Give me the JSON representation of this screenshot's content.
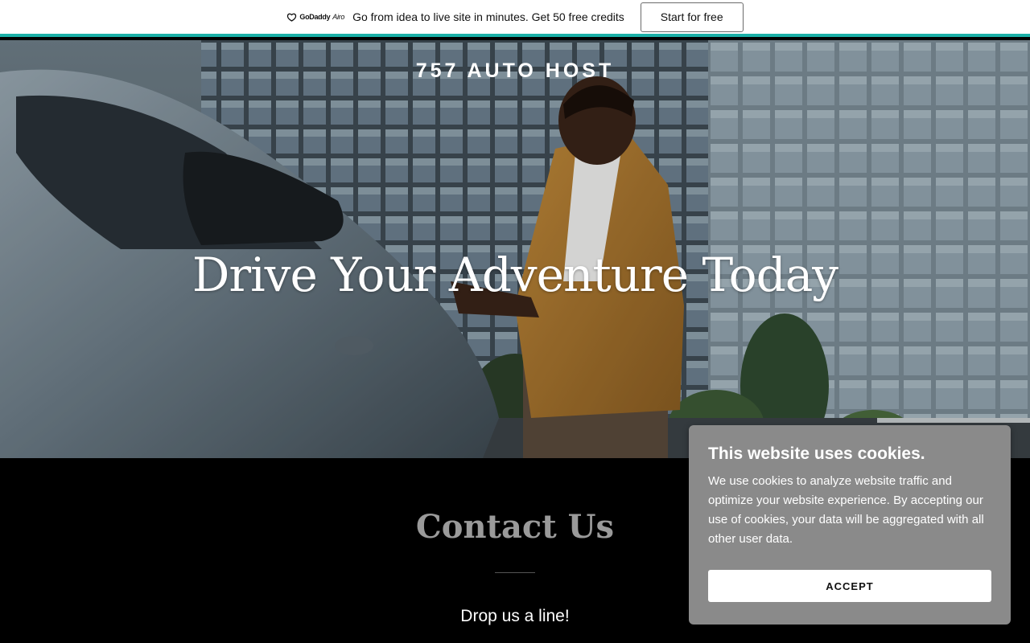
{
  "promo": {
    "logo_brand": "GoDaddy",
    "logo_product": "Airo",
    "message": "Go from idea to live site in minutes. Get 50 free credits",
    "cta_label": "Start for free",
    "accent_color": "#1bb0a8"
  },
  "hero": {
    "site_title": "757 AUTO HOST",
    "heading": "Drive Your Adventure Today"
  },
  "contact": {
    "title": "Contact Us",
    "subtitle": "Drop us a line!"
  },
  "cookie": {
    "title": "This website uses cookies.",
    "body": "We use cookies to analyze website traffic and optimize your website experience. By accepting our use of cookies, your data will be aggregated with all other user data.",
    "accept_label": "ACCEPT"
  }
}
